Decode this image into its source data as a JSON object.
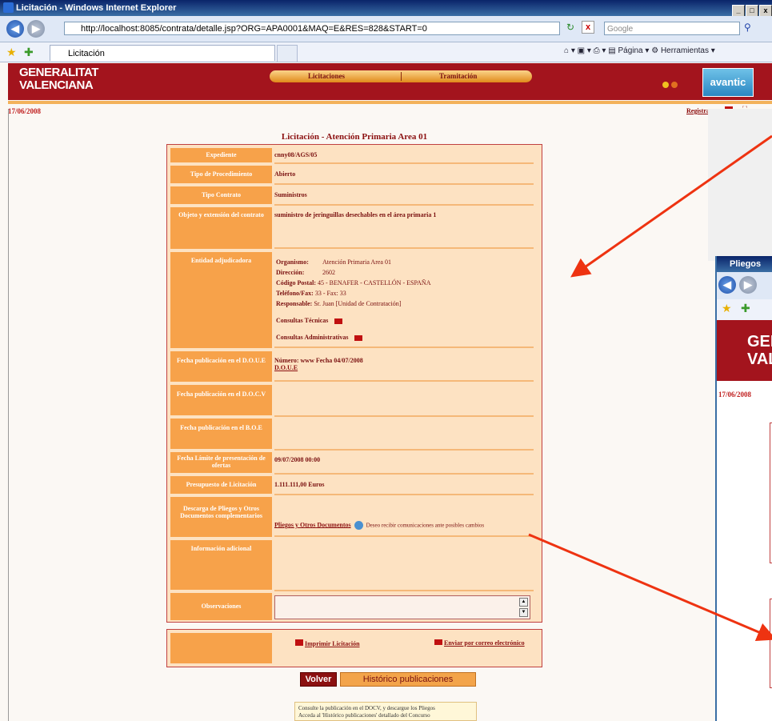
{
  "window": {
    "title": "Licitación - Windows Internet Explorer",
    "min": "_",
    "max": "□",
    "close": "x"
  },
  "address": {
    "url": "http://localhost:8085/contrata/detalle.jsp?ORG=APA0001&MAQ=E&RES=828&START=0",
    "search_placeholder": "Google"
  },
  "tab": {
    "label": "Licitación"
  },
  "toolbar": {
    "page_label": "Página",
    "tools_label": "Herramientas"
  },
  "site": {
    "logo_line1": "GENERALITAT",
    "logo_line2": "VALENCIANA",
    "menu": [
      "Licitaciones",
      "Tramitación"
    ],
    "brand": "avantic",
    "date": "17/06/2008",
    "register": "Registrarse"
  },
  "page_title": "Licitación - Atención Primaria Area 01",
  "form": {
    "expediente": {
      "label": "Expediente",
      "value": "cnny08/AGS/05"
    },
    "tipo_procedimiento": {
      "label": "Tipo de Procedimiento",
      "value": "Abierto"
    },
    "tipo_contrato": {
      "label": "Tipo Contrato",
      "value": "Suministros"
    },
    "objeto": {
      "label": "Objeto y extensión del contrato",
      "value": "suministro de jeringuillas desechables en el área primaria 1"
    },
    "entidad": {
      "label": "Entidad adjudicadora",
      "organismo_k": "Organismo:",
      "organismo_v": "Atención Primaria Area 01",
      "direccion_k": "Dirección:",
      "direccion_v": "2602",
      "cp_k": "Código Postal:",
      "cp_v": "45 - BENAFER - CASTELLÓN - ESPAÑA",
      "tel_k": "Teléfono/Fax:",
      "tel_v": "33 -   Fax:  33",
      "resp_k": "Responsable:",
      "resp_v": "Sr. Juan [Unidad de Contratación]",
      "consultas_tecnicas": "Consultas Técnicas",
      "consultas_admin": "Consultas Administrativas"
    },
    "doue": {
      "label": "Fecha publicación en el D.O.U.E",
      "value": "Número: www  Fecha 04/07/2008",
      "link": "D.O.U.E"
    },
    "docv": {
      "label": "Fecha publicación en el D.O.C.V"
    },
    "boe": {
      "label": "Fecha publicación en el B.O.E"
    },
    "fecha_limite": {
      "label": "Fecha Límite de presentación de ofertas",
      "value": "09/07/2008 00:00"
    },
    "presupuesto": {
      "label": "Presupuesto de Licitación",
      "value": "1.111.111,00 Euros"
    },
    "descarga": {
      "label": "Descarga de Pliegos y Otros Documentos complementarios",
      "link": "Pliegos y Otros Documentos",
      "note": "Deseo recibir comunicaciones ante posibles cambios"
    },
    "info": {
      "label": "Información adicional"
    },
    "observaciones": {
      "label": "Observaciones"
    }
  },
  "actions": {
    "print": "Imprimir Licitación",
    "email": "Enviar por correo electrónico"
  },
  "buttons": {
    "back": "Volver",
    "history": "Histórico publicaciones"
  },
  "note": {
    "line1": "Consulte la publicación en el DOCV, y descargue los Pliegos",
    "line2": "Acceda al 'Histórico publicaciones' detallado del Concurso"
  },
  "window2": {
    "title": "Pliegos",
    "logo": "GEN VAL",
    "date": "17/06/2008"
  },
  "colors": {
    "header": "#a3141d",
    "label_bg": "#f7a24a",
    "form_bg": "#fde2c2",
    "arrow": "#ee3311"
  }
}
